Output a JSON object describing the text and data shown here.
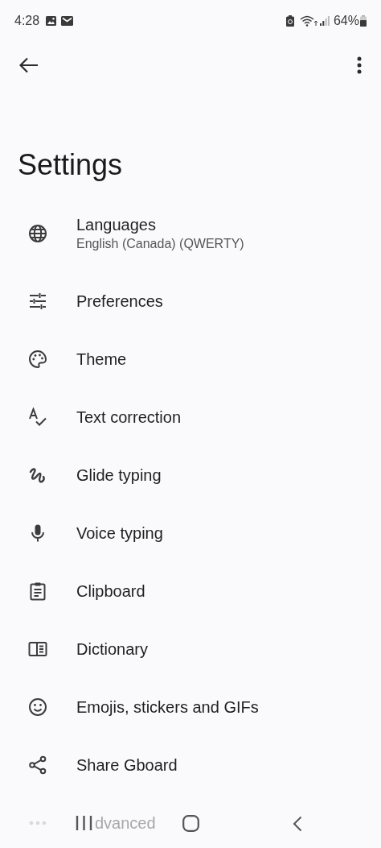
{
  "status_bar": {
    "time": "4:28",
    "battery": "64%"
  },
  "title": "Settings",
  "items": [
    {
      "label": "Languages",
      "sublabel": "English (Canada) (QWERTY)"
    },
    {
      "label": "Preferences"
    },
    {
      "label": "Theme"
    },
    {
      "label": "Text correction"
    },
    {
      "label": "Glide typing"
    },
    {
      "label": "Voice typing"
    },
    {
      "label": "Clipboard"
    },
    {
      "label": "Dictionary"
    },
    {
      "label": "Emojis, stickers and GIFs"
    },
    {
      "label": "Share Gboard"
    }
  ],
  "advanced": {
    "label": "dvanced"
  }
}
